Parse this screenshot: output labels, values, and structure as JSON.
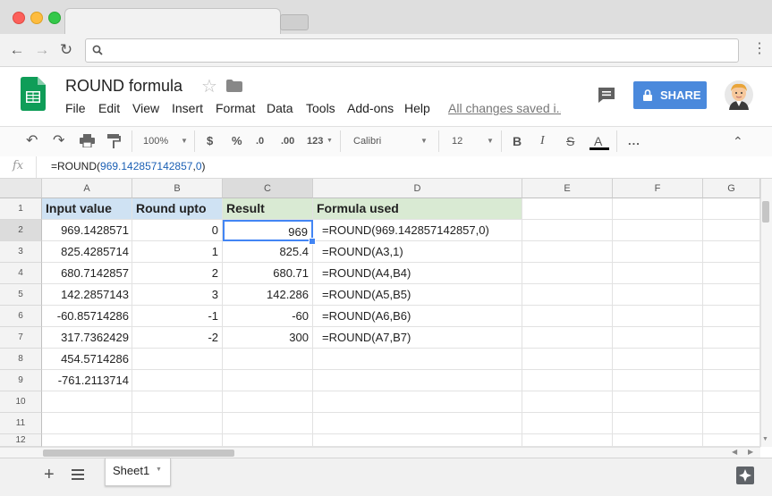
{
  "browser": {
    "traffic_lights": [
      "#fc605b",
      "#fdbc40",
      "#34c84a"
    ]
  },
  "doc": {
    "title": "ROUND formula",
    "menu": [
      "File",
      "Edit",
      "View",
      "Insert",
      "Format",
      "Data",
      "Tools",
      "Add-ons",
      "Help"
    ],
    "saved_status": "All changes saved i...",
    "share_label": "SHARE"
  },
  "toolbar": {
    "zoom": "100%",
    "currency": "$",
    "percent": "%",
    "decrease_decimals": ".0",
    "increase_decimals": ".00",
    "more_formats": "123",
    "font": "Calibri",
    "font_size": "12",
    "bold": "B",
    "italic": "I",
    "strikethrough": "S",
    "text_color": "A",
    "more": "..."
  },
  "formula_bar": {
    "fx_label": "fx",
    "prefix": "=ROUND(",
    "arg1": "969.142857142857",
    "comma": ",",
    "arg2": "0",
    "suffix": ")"
  },
  "grid": {
    "columns": [
      "A",
      "B",
      "C",
      "D",
      "E",
      "F",
      "G"
    ],
    "row_numbers": [
      "1",
      "2",
      "3",
      "4",
      "5",
      "6",
      "7",
      "8",
      "9",
      "10",
      "11",
      "12"
    ],
    "header_row": [
      "Input value",
      "Round upto",
      "Result",
      "Formula used"
    ],
    "rows": [
      [
        "969.1428571",
        "0",
        "969",
        "=ROUND(969.142857142857,0)"
      ],
      [
        "825.4285714",
        "1",
        "825.4",
        "=ROUND(A3,1)"
      ],
      [
        "680.7142857",
        "2",
        "680.71",
        "=ROUND(A4,B4)"
      ],
      [
        "142.2857143",
        "3",
        "142.286",
        "=ROUND(A5,B5)"
      ],
      [
        "-60.85714286",
        "-1",
        "-60",
        "=ROUND(A6,B6)"
      ],
      [
        "317.7362429",
        "-2",
        "300",
        "=ROUND(A7,B7)"
      ],
      [
        "454.5714286",
        "",
        "",
        ""
      ],
      [
        "-761.2113714",
        "",
        "",
        ""
      ],
      [
        "",
        "",
        "",
        ""
      ],
      [
        "",
        "",
        "",
        ""
      ],
      [
        "",
        "",
        "",
        ""
      ]
    ],
    "header_colors": {
      "a": "#cfe2f3",
      "b": "#cfe2f3",
      "c": "#d9ead3",
      "d": "#d9ead3"
    }
  },
  "sheets": {
    "tabs": [
      "Sheet1"
    ]
  }
}
